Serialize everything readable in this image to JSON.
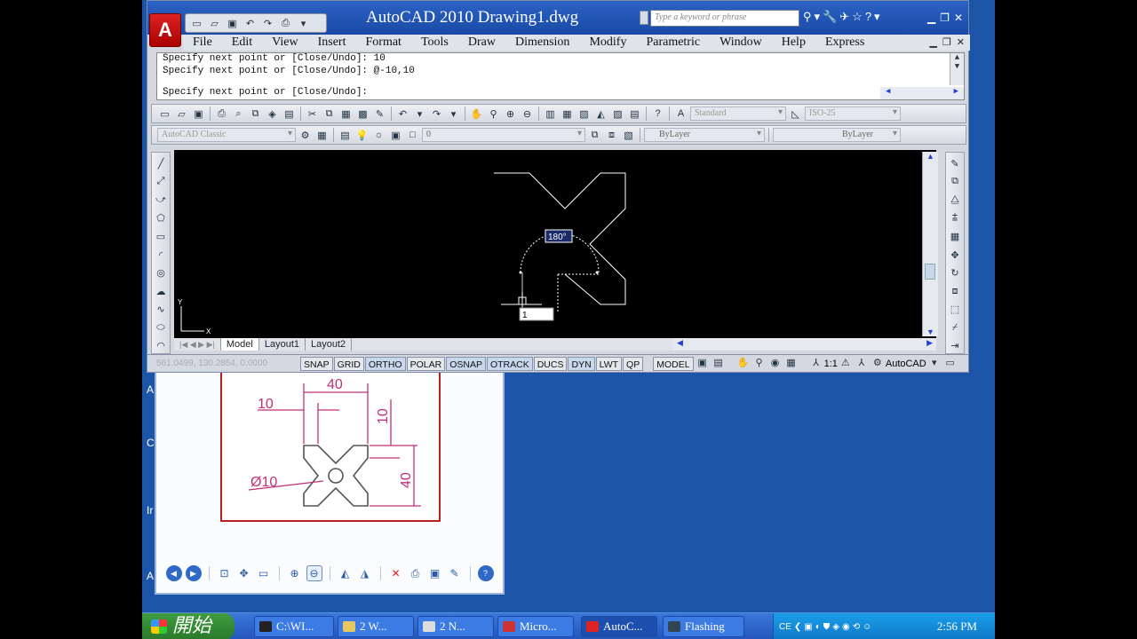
{
  "window": {
    "title": "AutoCAD 2010  Drawing1.dwg",
    "search_placeholder": "Type a keyword or phrase"
  },
  "menu": [
    "File",
    "Edit",
    "View",
    "Insert",
    "Format",
    "Tools",
    "Draw",
    "Dimension",
    "Modify",
    "Parametric",
    "Window",
    "Help",
    "Express"
  ],
  "command_line": {
    "history": [
      "Specify next point or [Close/Undo]: 10",
      "Specify next point or [Close/Undo]: @-10,10"
    ],
    "prompt": "Specify next point or [Close/Undo]:"
  },
  "toolbars": {
    "text_style": "Standard",
    "dim_style": "ISO-25",
    "workspace": "AutoCAD Classic",
    "layer": "0",
    "color": "ByLayer",
    "linetype": "ByLayer"
  },
  "canvas": {
    "angle_tooltip": "180°",
    "input_value": "1"
  },
  "layout_tabs": [
    "Model",
    "Layout1",
    "Layout2"
  ],
  "status": {
    "coordinates": "561.0499, 130.2854, 0.0000",
    "toggles": [
      {
        "label": "SNAP",
        "on": false
      },
      {
        "label": "GRID",
        "on": false
      },
      {
        "label": "ORTHO",
        "on": true
      },
      {
        "label": "POLAR",
        "on": false
      },
      {
        "label": "OSNAP",
        "on": true
      },
      {
        "label": "OTRACK",
        "on": true
      },
      {
        "label": "DUCS",
        "on": false
      },
      {
        "label": "DYN",
        "on": true
      },
      {
        "label": "LWT",
        "on": false
      },
      {
        "label": "QP",
        "on": false
      }
    ],
    "model": "MODEL",
    "annotation_scale": "1:1",
    "workspace": "AutoCAD"
  },
  "reference_drawing": {
    "dim_width": "40",
    "dim_offset": "10",
    "dim_top": "10",
    "dim_height": "40",
    "dim_diameter": "Ø10"
  },
  "taskbar": {
    "start": "開始",
    "tasks": [
      "C:\\WI...",
      "2 W...",
      "2 N...",
      "Micro...",
      "AutoC...",
      "Flashing"
    ],
    "clock": "2:56 PM"
  },
  "colors": {
    "taskbar_blue": "#2456bc",
    "start_green": "#2a7a2a",
    "dim_pink": "#c0307a",
    "status_on": "#c8d6ee"
  }
}
